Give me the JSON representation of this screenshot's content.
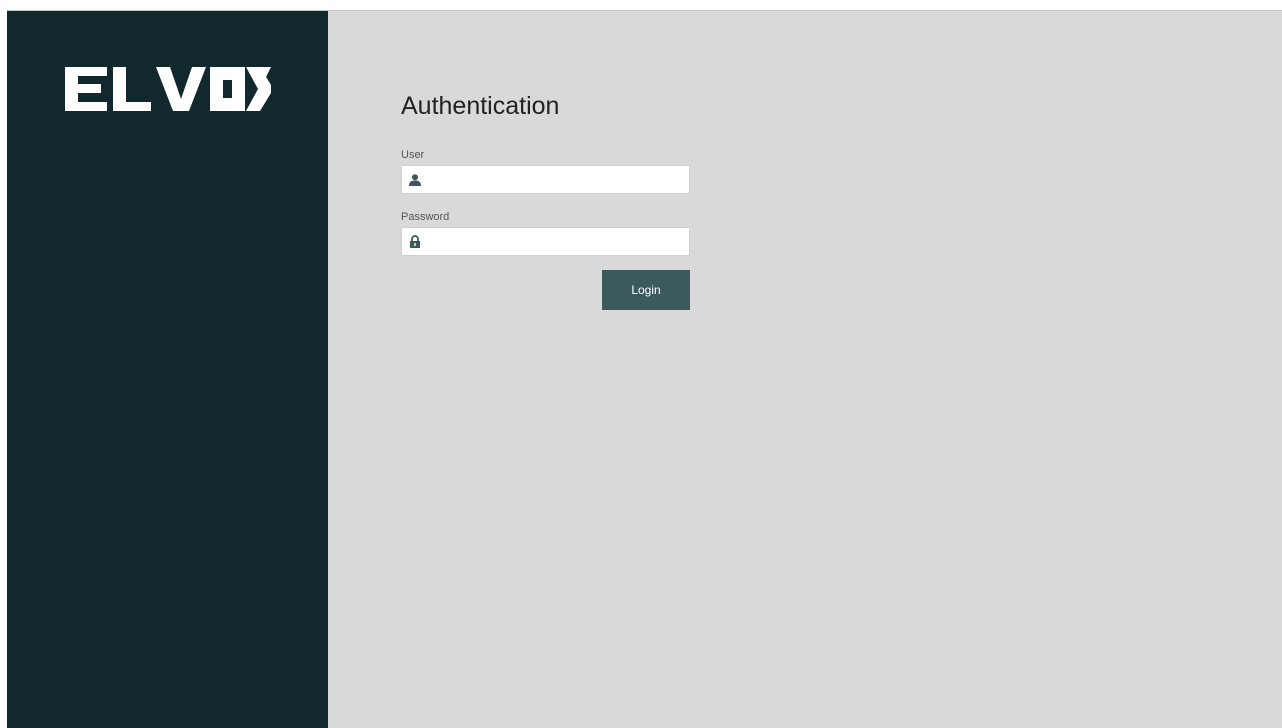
{
  "brand": {
    "logo_text": "ELVOX"
  },
  "auth": {
    "title": "Authentication",
    "user": {
      "label": "User",
      "value": "",
      "icon": "user-icon"
    },
    "password": {
      "label": "Password",
      "value": "",
      "icon": "lock-icon"
    },
    "login_label": "Login"
  },
  "colors": {
    "sidebar": "#11292d",
    "background": "#d8d9d8",
    "accent": "#3c5a5e",
    "icon": "#3c5a5e"
  }
}
